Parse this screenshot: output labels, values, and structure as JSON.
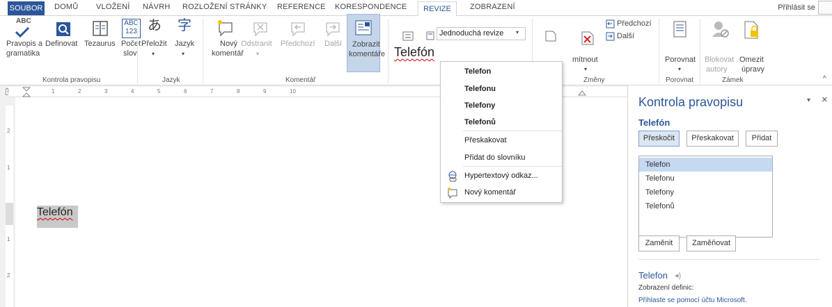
{
  "tabs": [
    "SOUBOR",
    "DOMŮ",
    "VLOŽENÍ",
    "NÁVRH",
    "ROZLOŽENÍ STRÁNKY",
    "REFERENCE",
    "KORESPONDENCE",
    "REVIZE",
    "ZOBRAZENÍ"
  ],
  "signin": "Přihlásit se",
  "ribbon": {
    "spelling": [
      "Pravopis a",
      "gramatika"
    ],
    "define": "Definovat",
    "thesaurus": "Tezaurus",
    "wordcount": [
      "Počet",
      "slov"
    ],
    "abc": [
      "ABC",
      "123"
    ],
    "group_proofing": "Kontrola pravopisu",
    "translate": "Přeložit",
    "language": "Jazyk",
    "group_language": "Jazyk",
    "new_comment": [
      "Nový",
      "komentář"
    ],
    "delete": "Odstranit",
    "previous": "Předchozí",
    "next": "Další",
    "show_comments": [
      "Zobrazit",
      "komentáře"
    ],
    "group_comments": "Komentář",
    "tracking_display": "Jednoduchá revize",
    "reject_fragment": "mítnout",
    "prev_change": "Předchozí",
    "next_change": "Další",
    "group_changes": "Změny",
    "compare": "Porovnat",
    "group_compare": "Porovnat",
    "block_authors": [
      "Blokovat",
      "autory"
    ],
    "restrict_editing": [
      "Omezit",
      "úpravy"
    ],
    "group_protect": "Zámek"
  },
  "ruler_numbers": [
    "1",
    "2",
    "3",
    "4",
    "5",
    "6",
    "7",
    "8",
    "9",
    "10"
  ],
  "vruler_numbers": [
    "2",
    "1",
    "1",
    "2"
  ],
  "document": {
    "word": "Telefón",
    "floating_word": "Telefón"
  },
  "context_menu": {
    "suggestions": [
      "Telefon",
      "Telefonu",
      "Telefony",
      "Telefonů"
    ],
    "ignore": "Přeskakovat",
    "add_dictionary": "Přidat do slovníku",
    "hyperlink": "Hypertextový odkaz...",
    "new_comment": "Nový komentář"
  },
  "pane": {
    "title": "Kontrola pravopisu",
    "word": "Telefón",
    "skip": "Přeskočit",
    "ignore_all": "Přeskakovat",
    "add": "Přidat",
    "suggestions": [
      "Telefon",
      "Telefonu",
      "Telefony",
      "Telefonů"
    ],
    "change": "Zaměnit",
    "change_all": "Zaměňovat",
    "def_word": "Telefon",
    "def_label": "Zobrazení definic:",
    "signin_link": "Přihlaste se pomocí účtu Microsoft."
  },
  "colors": {
    "accent": "#2b579a",
    "error": "#d00000",
    "selection": "#c5d9f1"
  }
}
